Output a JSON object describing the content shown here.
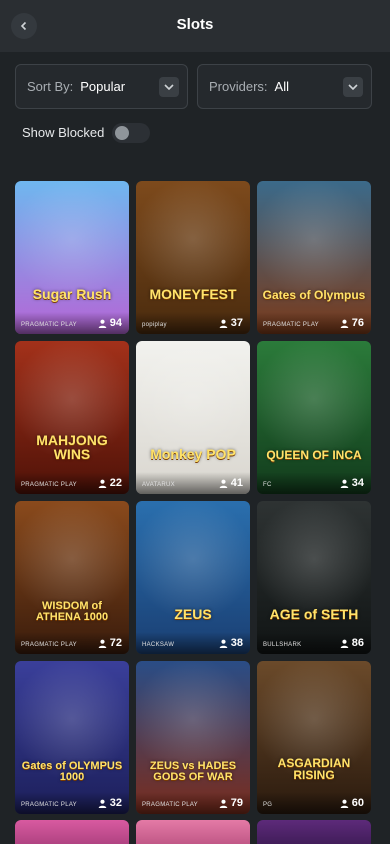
{
  "header": {
    "title": "Slots",
    "back_icon": "chevron-left-icon"
  },
  "filters": {
    "sort_label": "Sort By:",
    "sort_value": "Popular",
    "providers_label": "Providers:",
    "providers_value": "All",
    "show_blocked_label": "Show Blocked",
    "show_blocked_on": false
  },
  "games": [
    {
      "name": "Sugar Rush",
      "provider": "PRAGMATIC PLAY",
      "players": "94",
      "colors": [
        "#6fb7ef",
        "#b565d6"
      ]
    },
    {
      "name": "MONEYFEST",
      "provider": "popiplay",
      "players": "37",
      "colors": [
        "#7d4a1c",
        "#4a2b0e"
      ]
    },
    {
      "name": "Gates of Olympus",
      "provider": "PRAGMATIC PLAY",
      "players": "76",
      "colors": [
        "#3b6a8a",
        "#7a3a1a"
      ]
    },
    {
      "name": "MAHJONG WINS",
      "provider": "PRAGMATIC PLAY",
      "players": "22",
      "colors": [
        "#a3311a",
        "#4f1208"
      ]
    },
    {
      "name": "Monkey POP",
      "provider": "AVATARUX",
      "players": "41",
      "colors": [
        "#f2f2ee",
        "#d9d6cf"
      ]
    },
    {
      "name": "QUEEN OF INCA",
      "provider": "FC",
      "players": "34",
      "colors": [
        "#2b7b3a",
        "#123b1c"
      ]
    },
    {
      "name": "WISDOM of ATHENA 1000",
      "provider": "PRAGMATIC PLAY",
      "players": "72",
      "colors": [
        "#8a4a1c",
        "#3a1c0c"
      ]
    },
    {
      "name": "ZEUS",
      "provider": "HACKSAW",
      "players": "38",
      "colors": [
        "#2a6fae",
        "#1a3f73"
      ]
    },
    {
      "name": "AGE of SETH",
      "provider": "BULLSHARK",
      "players": "86",
      "colors": [
        "#2e3333",
        "#101414"
      ]
    },
    {
      "name": "Gates of OLYMPUS 1000",
      "provider": "PRAGMATIC PLAY",
      "players": "32",
      "colors": [
        "#3a3f9a",
        "#1c1f5a"
      ]
    },
    {
      "name": "ZEUS vs HADES GODS OF WAR",
      "provider": "PRAGMATIC PLAY",
      "players": "79",
      "colors": [
        "#2a4d86",
        "#7a2c1c"
      ]
    },
    {
      "name": "ASGARDIAN RISING",
      "provider": "PG",
      "players": "60",
      "colors": [
        "#6b4a2a",
        "#2a1a0e"
      ]
    }
  ],
  "icons": {
    "player_icon": "user-icon",
    "dropdown_icon": "chevron-down-icon"
  }
}
